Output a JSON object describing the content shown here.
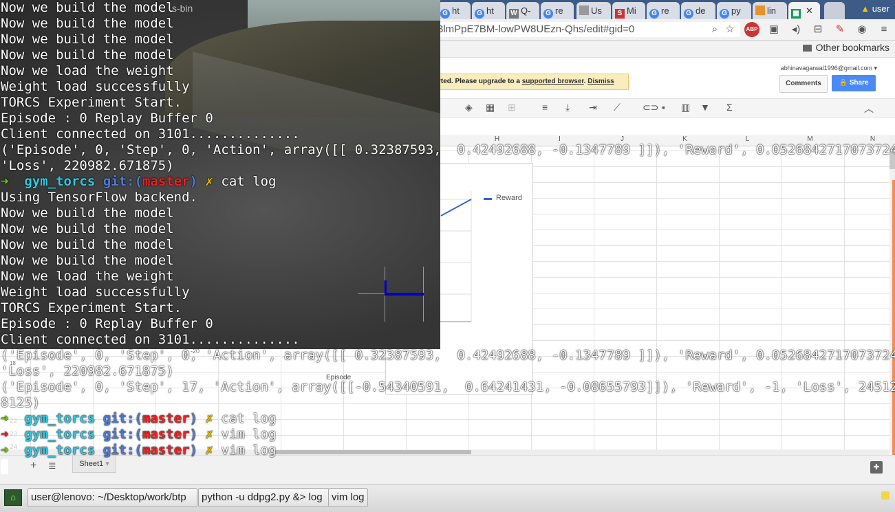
{
  "browser": {
    "tabs": [
      {
        "label": "ht",
        "icon": "google-icon"
      },
      {
        "label": "ht",
        "icon": "google-icon"
      },
      {
        "label": "Q-",
        "icon": "wikipedia-icon"
      },
      {
        "label": "re",
        "icon": "google-icon"
      },
      {
        "label": "Us",
        "icon": "document-icon"
      },
      {
        "label": "Mi",
        "icon": "s-icon"
      },
      {
        "label": "re",
        "icon": "google-icon"
      },
      {
        "label": "de",
        "icon": "google-icon"
      },
      {
        "label": "py",
        "icon": "google-icon"
      },
      {
        "label": "lin",
        "icon": "page-icon"
      },
      {
        "label": "",
        "icon": "sheets-icon"
      }
    ],
    "user_label": "user",
    "url": "3lmPpE7BM-lowPW8UEzn-Qhs/edit#gid=0",
    "other_bookmarks": "Other bookmarks"
  },
  "sheets": {
    "warning_text": "rted. Please upgrade to a ",
    "warning_link": "supported browser",
    "dismiss": "Dismiss",
    "account": "abhinavagarwal1996@gmail.com",
    "comments": "Comments",
    "share": "Share",
    "columns": [
      "H",
      "I",
      "J",
      "K",
      "L",
      "M",
      "N"
    ],
    "chart_legend": "Reward",
    "chart_xlabel": "Episode",
    "chart_tick": "-20",
    "row_numbers": [
      "18",
      "22",
      "23",
      "24"
    ],
    "sheet_tab": "Sheet1"
  },
  "torcs": {
    "title": "s-bin"
  },
  "terminal": {
    "lines_plain": [
      "Now we build the model",
      "Now we build the model",
      "Now we build the model",
      "Now we build the model",
      "Now we load the weight",
      "Weight load successfully",
      "TORCS Experiment Start.",
      "Episode : 0 Replay Buffer 0",
      "Client connected on 3101..............",
      "('Episode', 0, 'Step', 0, 'Action', array([[ 0.32387593,  0.42492688, -0.1347789 ]]), 'Reward', 0.052684271707372429,",
      "'Loss', 220982.671875)"
    ],
    "prompt1": {
      "dir": "gym_torcs",
      "git": "git:(",
      "branch": "master",
      "git_end": ")",
      "x": "✗",
      "cmd": "cat log"
    },
    "lines_plain2": [
      "Using TensorFlow backend.",
      "Now we build the model",
      "Now we build the model",
      "Now we build the model",
      "Now we build the model",
      "Now we load the weight",
      "Weight load successfully",
      "TORCS Experiment Start.",
      "Episode : 0 Replay Buffer 0",
      "Client connected on 3101..............",
      "('Episode', 0, 'Step', 0, 'Action', array([[ 0.32387593,  0.42492688, -0.1347789 ]]), 'Reward', 0.052684271707372429,",
      "'Loss', 220982.671875)",
      "('Episode', 0, 'Step', 17, 'Action', array([[-0.54340591,  0.64241431, -0.08655793]]), 'Reward', -1, 'Loss', 245125.82",
      "8125)"
    ],
    "prompt2": {
      "dir": "gym_torcs",
      "git": "git:(",
      "branch": "master",
      "git_end": ")",
      "x": "✗",
      "cmd": "cat log"
    },
    "prompt3": {
      "dir": "gym_torcs",
      "git": "git:(",
      "branch": "master",
      "git_end": ")",
      "x": "✗",
      "cmd": "vim log"
    },
    "prompt4": {
      "dir": "gym_torcs",
      "git": "git:(",
      "branch": "master",
      "git_end": ")",
      "x": "✗",
      "cmd": "vim log"
    },
    "arrow": "➜"
  },
  "taskbar": {
    "tasks": [
      "user@lenovo: ~/Desktop/work/btp",
      "python -u ddpg2.py &> log",
      "vim log"
    ]
  }
}
